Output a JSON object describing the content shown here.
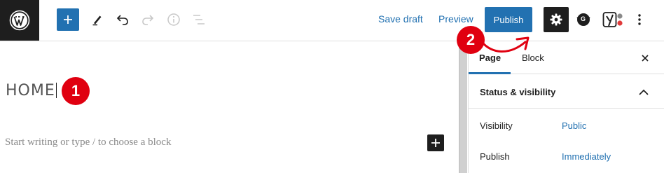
{
  "toolbar": {
    "save_draft_label": "Save draft",
    "preview_label": "Preview",
    "publish_label": "Publish",
    "plugin_g_letter": "G"
  },
  "editor": {
    "title": "HOME",
    "placeholder": "Start writing or type / to choose a block"
  },
  "annotations": {
    "step1": "1",
    "step2": "2"
  },
  "sidebar": {
    "tabs": [
      {
        "label": "Page",
        "active": true
      },
      {
        "label": "Block",
        "active": false
      }
    ],
    "panel_title": "Status & visibility",
    "rows": [
      {
        "label": "Visibility",
        "value": "Public"
      },
      {
        "label": "Publish",
        "value": "Immediately"
      }
    ]
  },
  "colors": {
    "accent": "#2271b1",
    "dark": "#1e1e1e",
    "marker": "#e00010"
  }
}
